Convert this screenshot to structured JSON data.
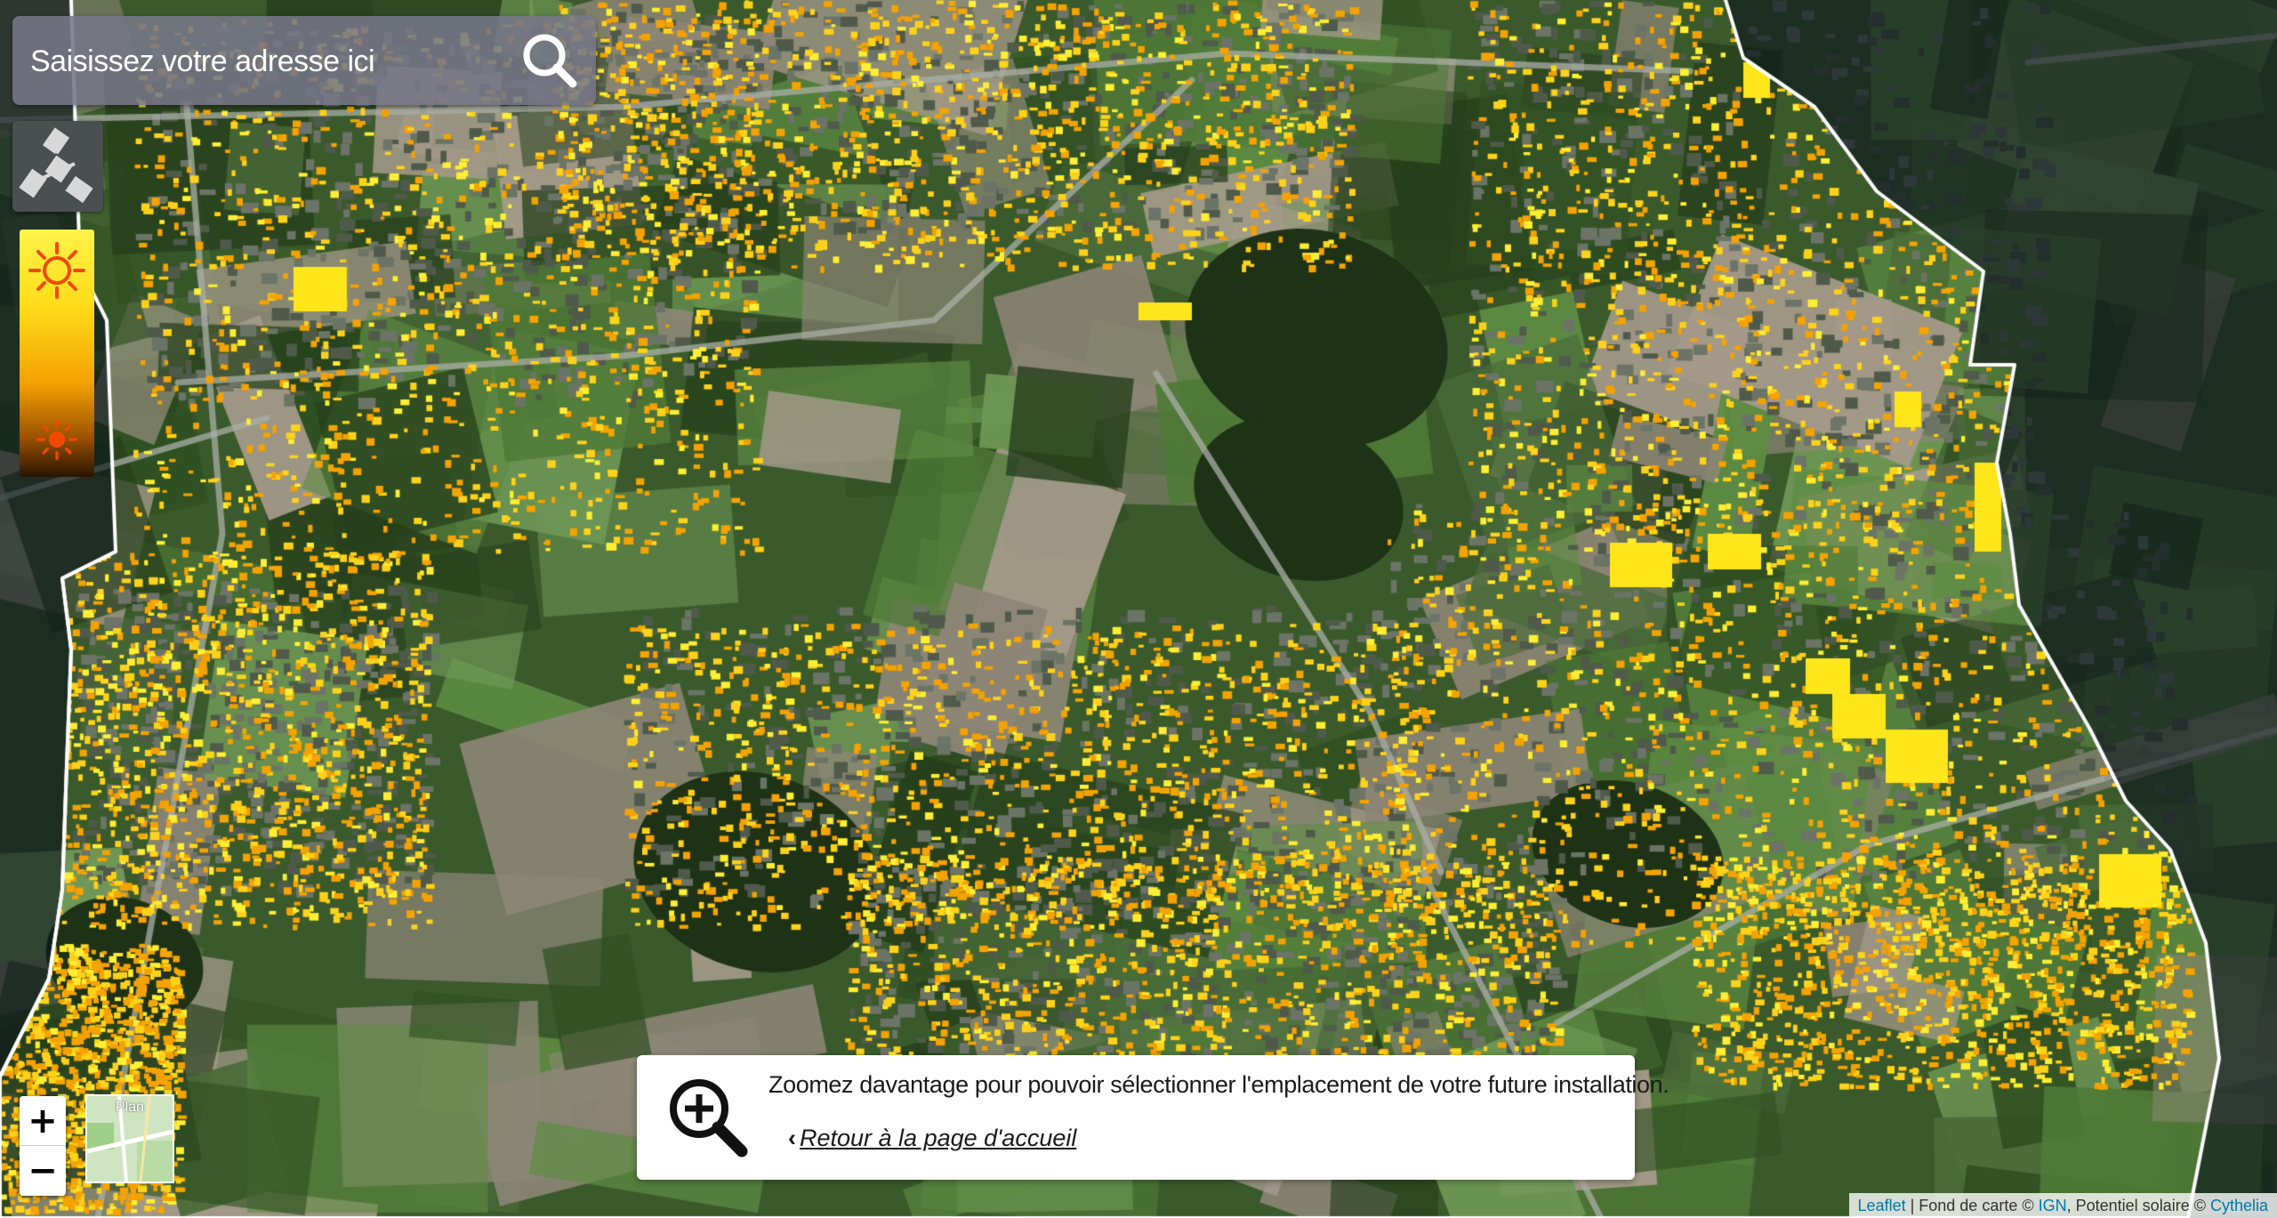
{
  "search": {
    "placeholder": "Saisissez votre adresse ici",
    "icon": "search-icon"
  },
  "layers": {
    "satellite_icon": "satellite-icon"
  },
  "legend": {
    "gradient_colors": [
      "#fff34a",
      "#ffdd1a",
      "#f4a200",
      "#9c5200",
      "#2a1500"
    ],
    "high_icon": "sun-icon",
    "low_icon": "sun-icon"
  },
  "zoom": {
    "in_label": "+",
    "out_label": "−"
  },
  "basemap_switch": {
    "label": "Plan"
  },
  "info": {
    "icon": "zoom-in-magnifier-icon",
    "message": "Zoomez davantage pour pouvoir sélectionner l'emplacement de votre future installation.",
    "back_label": "Retour à la page d'accueil"
  },
  "attribution": {
    "leaflet": "Leaflet",
    "sep1": " | Fond de carte © ",
    "ign": "IGN",
    "sep2": ", Potentiel solaire © ",
    "cythelia": "Cythelia"
  },
  "colors": {
    "boundary": "#ffffff",
    "roof_high": "#ffe61a",
    "roof_mid": "#f5a300",
    "vegetation": "#3f6a2c",
    "outside_dim": "#1a2520"
  }
}
